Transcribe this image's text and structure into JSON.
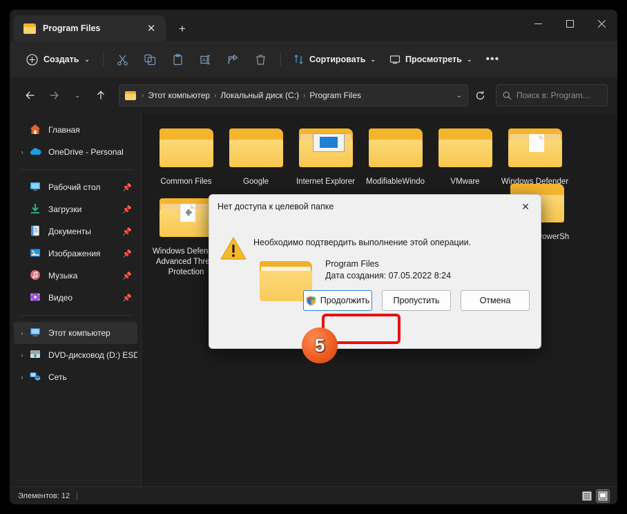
{
  "window": {
    "tab_title": "Program Files",
    "tab_close_glyph": "✕",
    "new_tab_glyph": "+",
    "minimize_label": "Свернуть",
    "maximize_label": "Развернуть",
    "close_label": "Закрыть"
  },
  "toolbar": {
    "new_label": "Создать",
    "chevron": "⌄",
    "cut_label": "Вырезать",
    "copy_label": "Копировать",
    "paste_label": "Вставить",
    "rename_label": "Переименовать",
    "share_label": "Поделиться",
    "delete_label": "Удалить",
    "sort_label": "Сортировать",
    "view_label": "Просмотреть",
    "more_glyph": "•••"
  },
  "addressbar": {
    "back_label": "Назад",
    "forward_label": "Вперёд",
    "recent_label": "Последние расположения",
    "up_label": "Вверх",
    "crumbs": [
      "Этот компьютер",
      "Локальный диск (C:)",
      "Program Files"
    ],
    "separator": "›",
    "dropdown_chevron": "⌄",
    "refresh_label": "Обновить",
    "search_placeholder": "Поиск в: Program..."
  },
  "sidebar": {
    "items": [
      {
        "label": "Главная",
        "icon": "home-icon",
        "expandable": false,
        "pinned": false,
        "selected": false
      },
      {
        "label": "OneDrive - Personal",
        "icon": "onedrive-icon",
        "expandable": true,
        "pinned": false,
        "selected": false
      },
      {
        "separator": true
      },
      {
        "label": "Рабочий стол",
        "icon": "desktop-icon",
        "expandable": false,
        "pinned": true,
        "selected": false
      },
      {
        "label": "Загрузки",
        "icon": "downloads-icon",
        "expandable": false,
        "pinned": true,
        "selected": false
      },
      {
        "label": "Документы",
        "icon": "documents-icon",
        "expandable": false,
        "pinned": true,
        "selected": false
      },
      {
        "label": "Изображения",
        "icon": "pictures-icon",
        "expandable": false,
        "pinned": true,
        "selected": false
      },
      {
        "label": "Музыка",
        "icon": "music-icon",
        "expandable": false,
        "pinned": true,
        "selected": false
      },
      {
        "label": "Видео",
        "icon": "videos-icon",
        "expandable": false,
        "pinned": true,
        "selected": false
      },
      {
        "separator": true
      },
      {
        "label": "Этот компьютер",
        "icon": "this-pc-icon",
        "expandable": true,
        "pinned": false,
        "selected": true
      },
      {
        "label": "DVD-дисковод (D:) ESD-IS",
        "icon": "dvd-drive-icon",
        "expandable": true,
        "pinned": false,
        "selected": false
      },
      {
        "label": "Сеть",
        "icon": "network-icon",
        "expandable": true,
        "pinned": false,
        "selected": false
      }
    ],
    "pin_glyph": "📌",
    "expand_glyph": "›"
  },
  "files": [
    {
      "name": "Common Files",
      "icon": "folder-plain"
    },
    {
      "name": "Google",
      "icon": "folder-plain"
    },
    {
      "name": "Internet Explorer",
      "icon": "folder-ie"
    },
    {
      "name": "ModifiableWindo",
      "icon": "folder-plain"
    },
    {
      "name": "VMware",
      "icon": "folder-plain"
    },
    {
      "name": "Windows Defender",
      "icon": "folder-doc"
    },
    {
      "name": "Windows Defender Advanced Threat Protection",
      "icon": "folder-puzzle"
    },
    {
      "name": "WindowsPowerShell",
      "icon": "folder-plain"
    }
  ],
  "statusbar": {
    "items_text": "Элементов: 12",
    "separator": "|",
    "details_view_label": "Таблица",
    "large_icons_view_label": "Крупные значки"
  },
  "dialog": {
    "title": "Нет доступа к целевой папке",
    "close_glyph": "✕",
    "message": "Необходимо подтвердить выполнение этой операции.",
    "file_name": "Program Files",
    "file_date": "Дата создания: 07.05.2022 8:24",
    "buttons": [
      {
        "label": "Продолжить",
        "shield": true,
        "focused": true
      },
      {
        "label": "Пропустить",
        "shield": false,
        "focused": false
      },
      {
        "label": "Отмена",
        "shield": false,
        "focused": false
      }
    ]
  },
  "annotation": {
    "step_number": "5",
    "highlight_color": "#e81010",
    "badge_color": "#e8541a"
  }
}
